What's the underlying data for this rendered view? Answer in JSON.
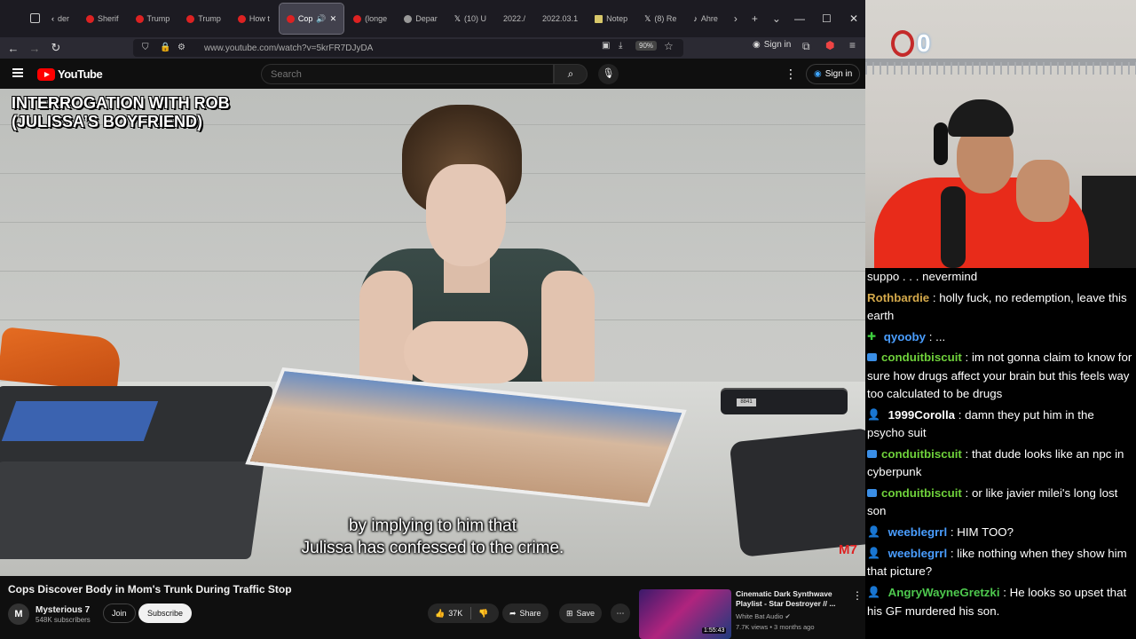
{
  "browser": {
    "tabs": [
      {
        "label": "der",
        "icon": "chevron-left-icon",
        "fav": "none"
      },
      {
        "label": "Sherif",
        "fav": "red"
      },
      {
        "label": "Trump",
        "fav": "red"
      },
      {
        "label": "Trump",
        "fav": "red"
      },
      {
        "label": "How t",
        "fav": "red"
      },
      {
        "label": "Cop",
        "fav": "red",
        "active": true
      },
      {
        "label": "(longe",
        "fav": "red"
      },
      {
        "label": "Depar",
        "fav": "grey"
      },
      {
        "label": "(10) U",
        "fav": "x"
      },
      {
        "label": "2022./",
        "fav": "none"
      },
      {
        "label": "2022.03.1",
        "fav": "none"
      },
      {
        "label": "Notep",
        "fav": "yellow"
      },
      {
        "label": "(8) Re",
        "fav": "x"
      },
      {
        "label": "Ahre",
        "fav": "tiktok"
      }
    ],
    "url": "www.youtube.com/watch?v=5krFR7DJyDA",
    "zoom": "90%",
    "signin_label": "Sign in"
  },
  "youtube": {
    "logo_text": "YouTube",
    "search_placeholder": "Search",
    "signin_label": "Sign in",
    "video": {
      "overlay_title": "INTERROGATION WITH ROB\n(JULISSA’S BOYFRIEND)",
      "subtitles": "by implying to him that\nJulissa has confessed to the crime.",
      "watermark": "M7",
      "recorder_label": "8841"
    },
    "title": "Cops Discover Body in Mom's Trunk During Traffic Stop",
    "channel": {
      "avatar_letter": "M",
      "name": "Mysterious 7",
      "subscribers": "548K subscribers",
      "join_label": "Join",
      "subscribe_label": "Subscribe"
    },
    "actions": {
      "likes": "37K",
      "share_label": "Share",
      "save_label": "Save"
    },
    "recommended": {
      "title": "Cinematic Dark Synthwave\nPlaylist - Star Destroyer // ...",
      "channel": "White Bat Audio",
      "meta": "7.7K views • 3 months ago",
      "duration": "1:55:43"
    }
  },
  "webcam": {
    "counter": "0"
  },
  "chat": [
    {
      "user": "",
      "text": "suppo . . . nevermind",
      "color": "#ffffff",
      "badge": ""
    },
    {
      "user": "Rothbardie",
      "text": " : holly fuck, no redemption, leave this earth",
      "color": "#d4a94b",
      "badge": ""
    },
    {
      "user": "qyooby",
      "text": " : ...",
      "color": "#4a9eff",
      "badge": "green"
    },
    {
      "user": "conduitbiscuit",
      "text": " : im not gonna claim to know for sure how drugs affect your brain but this feels way too calculated to be drugs",
      "color": "#6fd13b",
      "badge": "blue"
    },
    {
      "user": "1999Corolla",
      "text": " : damn they put him in the psycho suit",
      "color": "#ffffff",
      "badge": "person"
    },
    {
      "user": "conduitbiscuit",
      "text": " : that dude looks like an npc in cyberpunk",
      "color": "#6fd13b",
      "badge": "blue"
    },
    {
      "user": "conduitbiscuit",
      "text": " : or like javier milei's long lost son",
      "color": "#6fd13b",
      "badge": "blue"
    },
    {
      "user": "weeblegrrl",
      "text": " : HIM TOO?",
      "color": "#4a9eff",
      "badge": "person"
    },
    {
      "user": "weeblegrrl",
      "text": " : like nothing when they show him that picture?",
      "color": "#4a9eff",
      "badge": "person"
    },
    {
      "user": "AngryWayneGretzki",
      "text": " : He looks so upset that his GF murdered his son.",
      "color": "#4ec94e",
      "badge": "person"
    }
  ]
}
